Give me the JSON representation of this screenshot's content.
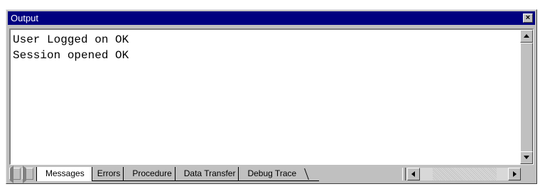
{
  "window": {
    "title": "Output",
    "close_icon": "close-icon"
  },
  "output": {
    "lines": [
      "User Logged on OK",
      "Session opened OK"
    ]
  },
  "tabs": [
    {
      "label": "Messages",
      "active": true
    },
    {
      "label": "Errors",
      "active": false
    },
    {
      "label": "Procedure",
      "active": false
    },
    {
      "label": "Data Transfer",
      "active": false
    },
    {
      "label": "Debug Trace",
      "active": false
    }
  ],
  "colors": {
    "titlebar": "#000080",
    "face": "#c0c0c0"
  }
}
